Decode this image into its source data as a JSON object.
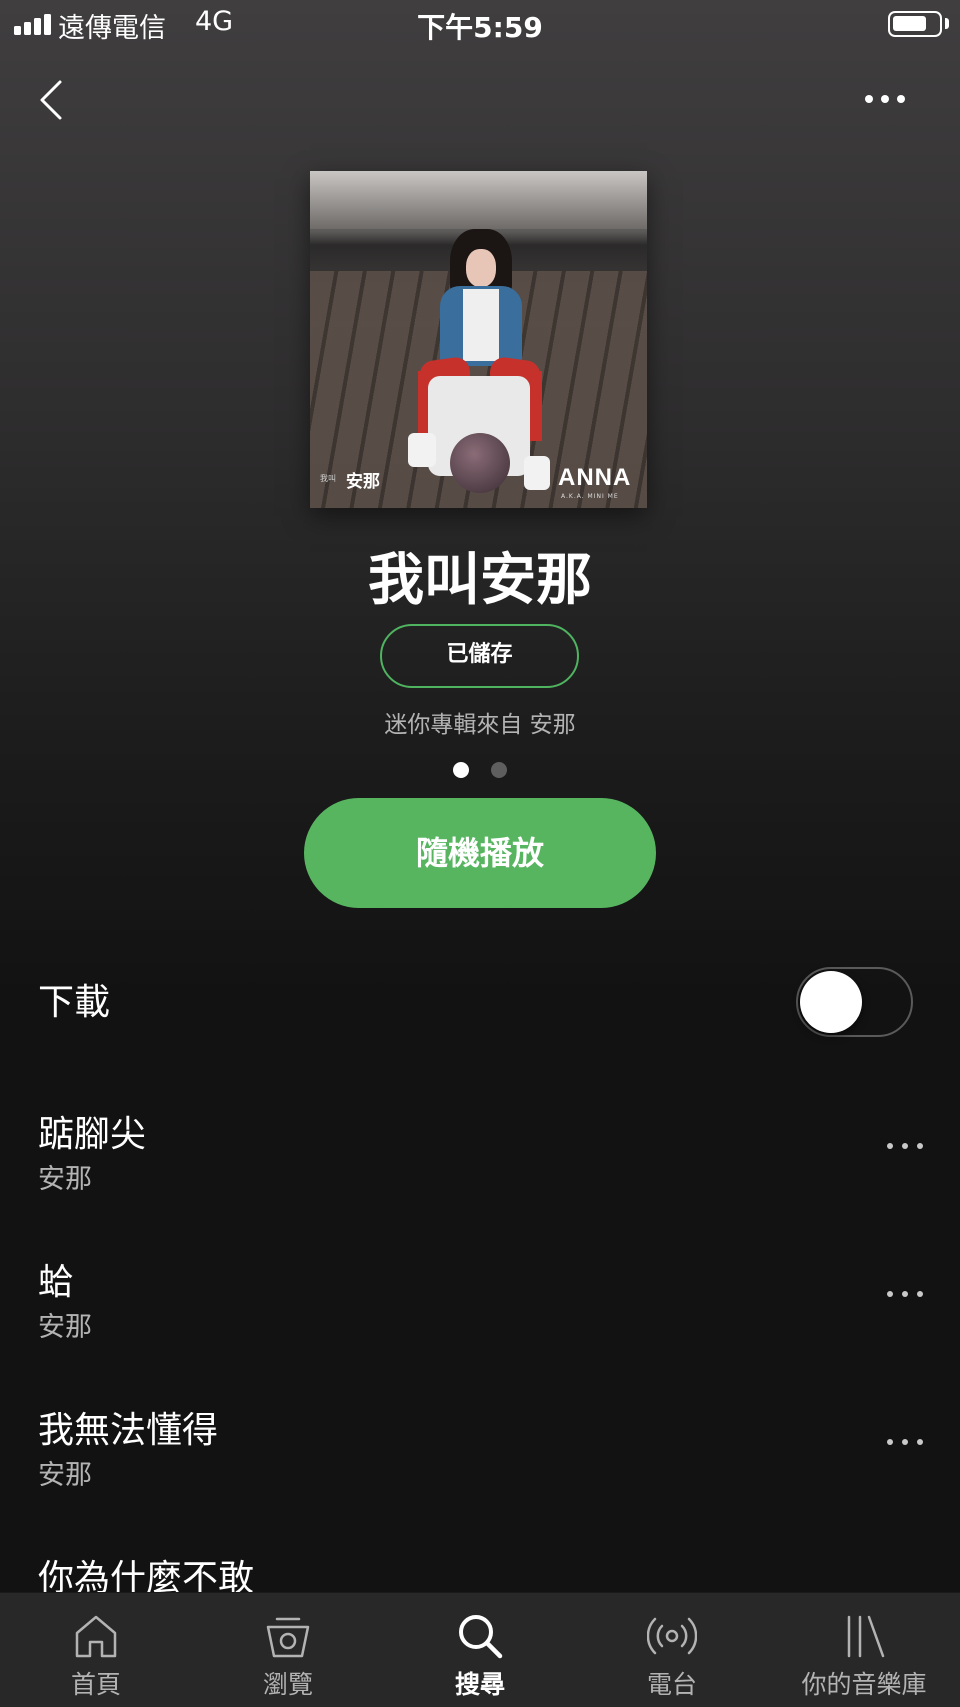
{
  "status_bar": {
    "carrier": "遠傳電信",
    "network": "4G",
    "time": "下午5:59",
    "battery_level": 0.75
  },
  "nav": {
    "back_icon": "chevron-left-icon",
    "more_icon": "more-horizontal-icon"
  },
  "album": {
    "cover_title": "ANNA",
    "cover_subtitle": "A.K.A. MINI ME",
    "cover_artist": "安那",
    "cover_prefix": "我叫",
    "title": "我叫安那",
    "saved_label": "已儲存",
    "subtitle": "迷你專輯來自 安那",
    "page_dots": {
      "count": 2,
      "active": 0
    },
    "shuffle_label": "隨機播放"
  },
  "download": {
    "label": "下載",
    "enabled": false
  },
  "tracks": [
    {
      "title": "踮腳尖",
      "artist": "安那"
    },
    {
      "title": "蛤",
      "artist": "安那"
    },
    {
      "title": "我無法懂得",
      "artist": "安那"
    },
    {
      "title": "你為什麼不敢",
      "artist": ""
    }
  ],
  "tab_bar": {
    "active_index": 2,
    "items": [
      {
        "label": "首頁",
        "icon": "home-icon"
      },
      {
        "label": "瀏覽",
        "icon": "browse-icon"
      },
      {
        "label": "搜尋",
        "icon": "search-icon"
      },
      {
        "label": "電台",
        "icon": "radio-icon"
      },
      {
        "label": "你的音樂庫",
        "icon": "library-icon"
      }
    ]
  },
  "colors": {
    "accent_green": "#57b560",
    "saved_border": "#4fb35f",
    "background": "#121212",
    "tab_bar": "#282828",
    "secondary_text": "#b3b3b3"
  }
}
